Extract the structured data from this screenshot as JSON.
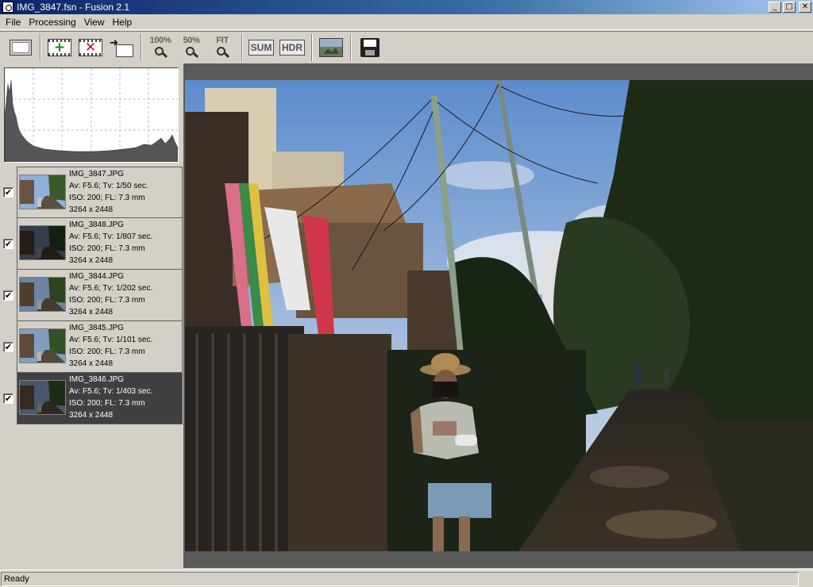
{
  "window": {
    "title": "IMG_3847.fsn - Fusion 2.1",
    "controls": [
      "_",
      "□",
      "✕"
    ]
  },
  "menu": [
    "File",
    "Processing",
    "View",
    "Help"
  ],
  "toolbar": {
    "zoom_100": "100%",
    "zoom_50": "50%",
    "zoom_fit": "FIT",
    "sum_label": "SUM",
    "hdr_label": "HDR"
  },
  "images": [
    {
      "name": "IMG_3847.JPG",
      "exposure": "Av: F5.6; Tv: 1/50 sec.",
      "iso_fl": "ISO: 200; FL: 7.3 mm",
      "size": "3264 x 2448",
      "checked": true,
      "selected": false,
      "brightness": 1.0
    },
    {
      "name": "IMG_3848.JPG",
      "exposure": "Av: F5.6; Tv: 1/807 sec.",
      "iso_fl": "ISO: 200; FL: 7.3 mm",
      "size": "3264 x 2448",
      "checked": true,
      "selected": false,
      "brightness": 0.35
    },
    {
      "name": "IMG_3844.JPG",
      "exposure": "Av: F5.6; Tv: 1/202 sec.",
      "iso_fl": "ISO: 200; FL: 7.3 mm",
      "size": "3264 x 2448",
      "checked": true,
      "selected": false,
      "brightness": 0.75
    },
    {
      "name": "IMG_3845.JPG",
      "exposure": "Av: F5.6; Tv: 1/101 sec.",
      "iso_fl": "ISO: 200; FL: 7.3 mm",
      "size": "3264 x 2448",
      "checked": true,
      "selected": false,
      "brightness": 0.9
    },
    {
      "name": "IMG_3846.JPG",
      "exposure": "Av: F5.6; Tv: 1/403 sec.",
      "iso_fl": "ISO: 200; FL: 7.3 mm",
      "size": "3264 x 2448",
      "checked": true,
      "selected": true,
      "brightness": 0.5
    }
  ],
  "status": "Ready"
}
